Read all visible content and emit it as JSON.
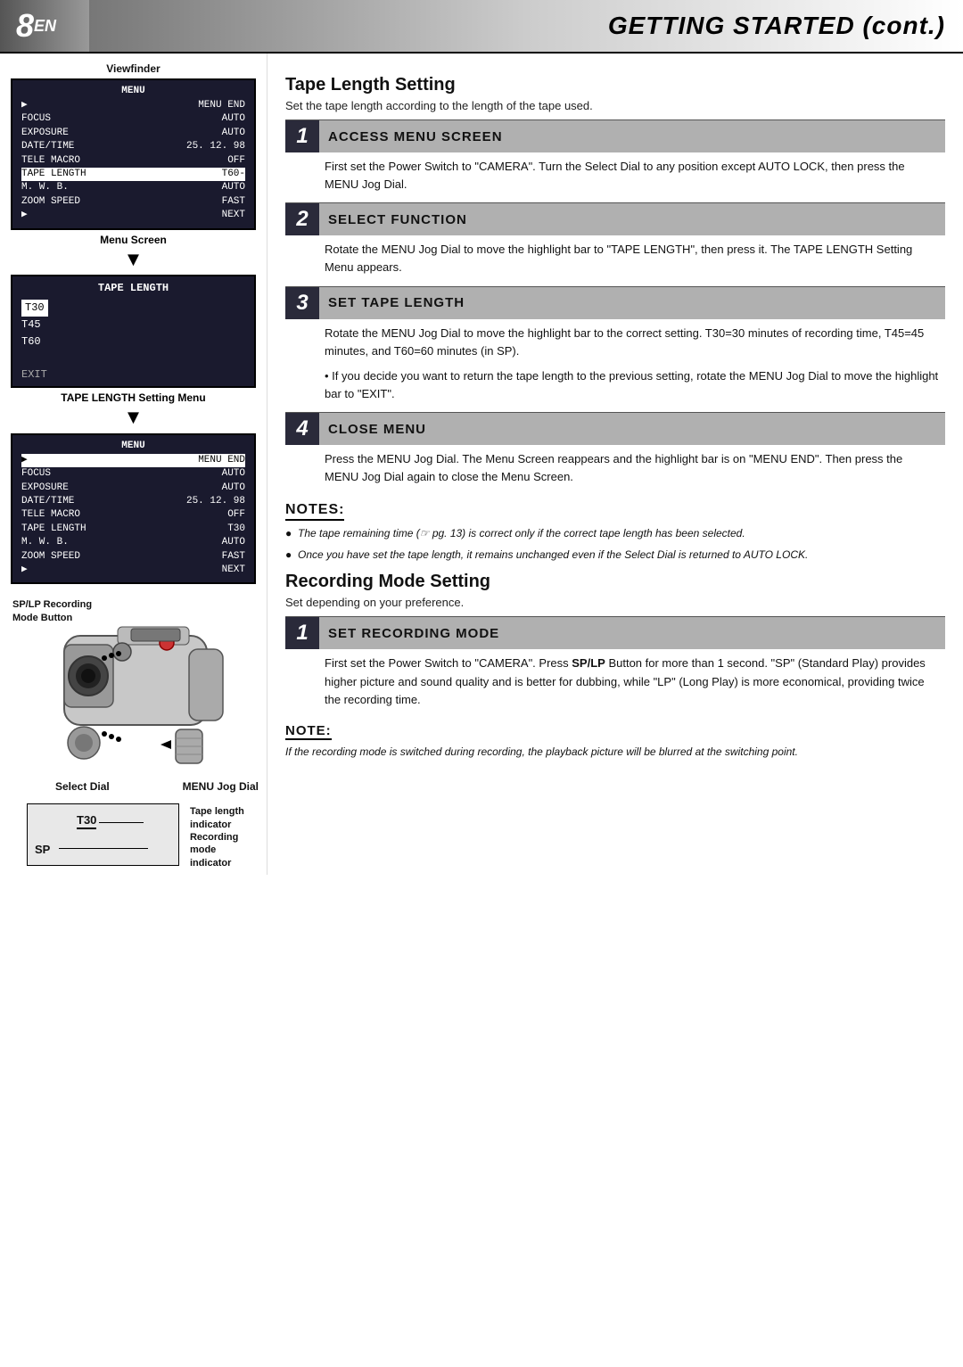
{
  "header": {
    "page_num": "8",
    "page_suffix": "EN",
    "title": "GETTING STARTED (cont.)"
  },
  "left_col": {
    "viewfinder_label": "Viewfinder",
    "menu_screen_label": "Menu Screen",
    "tape_length_menu_label": "TAPE LENGTH Setting Menu",
    "menu1": {
      "title": "MENU",
      "items": [
        {
          "label": "MENU END",
          "value": "",
          "arrow": true,
          "highlighted": false
        },
        {
          "label": "FOCUS",
          "value": "AUTO",
          "highlighted": false
        },
        {
          "label": "EXPOSURE",
          "value": "AUTO",
          "highlighted": false
        },
        {
          "label": "DATE/TIME",
          "value": "25. 12. 98",
          "highlighted": false
        },
        {
          "label": "TELE MACRO",
          "value": "OFF",
          "highlighted": false
        },
        {
          "label": "TAPE LENGTH",
          "value": "T60-",
          "highlighted": true
        },
        {
          "label": "M. W. B.",
          "value": "AUTO",
          "highlighted": false
        },
        {
          "label": "ZOOM SPEED",
          "value": "FAST",
          "highlighted": false
        },
        {
          "label": "NEXT",
          "value": "",
          "arrow": true,
          "highlighted": false
        }
      ]
    },
    "tape_length_box": {
      "title": "TAPE LENGTH",
      "items": [
        "T30",
        "T45",
        "T60"
      ],
      "selected": "T30",
      "exit_label": "EXIT"
    },
    "menu2": {
      "title": "MENU",
      "items": [
        {
          "label": "MENU END",
          "value": "",
          "arrow": true,
          "highlighted": true
        },
        {
          "label": "FOCUS",
          "value": "AUTO",
          "highlighted": false
        },
        {
          "label": "EXPOSURE",
          "value": "AUTO",
          "highlighted": false
        },
        {
          "label": "DATE/TIME",
          "value": "25. 12. 98",
          "highlighted": false
        },
        {
          "label": "TELE MACRO",
          "value": "OFF",
          "highlighted": false
        },
        {
          "label": "TAPE LENGTH",
          "value": "T30",
          "highlighted": false
        },
        {
          "label": "M. W. B.",
          "value": "AUTO",
          "highlighted": false
        },
        {
          "label": "ZOOM SPEED",
          "value": "FAST",
          "highlighted": false
        },
        {
          "label": "NEXT",
          "value": "",
          "arrow": true,
          "highlighted": false
        }
      ]
    },
    "sp_lp_label": "SP/LP Recording\nMode Button",
    "select_dial_label": "Select Dial",
    "menu_jog_label": "MENU Jog Dial",
    "indicator": {
      "sp": "SP",
      "t30": "T30",
      "tape_length_label": "Tape length\nindicator",
      "rec_mode_label": "Recording mode\nindicator"
    }
  },
  "right_col": {
    "tape_length": {
      "title": "Tape Length Setting",
      "desc": "Set the tape length according to the length of the tape used.",
      "steps": [
        {
          "number": "1",
          "header": "ACCESS MENU SCREEN",
          "body": "First set the Power Switch to \"CAMERA\". Turn the Select Dial to any position except AUTO LOCK, then press the MENU Jog Dial."
        },
        {
          "number": "2",
          "header": "SELECT FUNCTION",
          "body": "Rotate the MENU Jog Dial to move the highlight bar to \"TAPE LENGTH\", then press it. The TAPE LENGTH Setting Menu appears."
        },
        {
          "number": "3",
          "header": "SET TAPE LENGTH",
          "body": "Rotate the MENU Jog Dial to move the highlight bar to the correct setting. T30=30 minutes of recording time, T45=45 minutes, and T60=60 minutes (in SP).",
          "bullet": "If  you decide you want to return the tape length to the previous setting, rotate the MENU Jog Dial to move the highlight bar to \"EXIT\"."
        },
        {
          "number": "4",
          "header": "CLOSE MENU",
          "body": "Press the MENU Jog Dial. The Menu Screen reappears and the highlight bar is on \"MENU END\". Then press the MENU Jog Dial again to close the Menu Screen."
        }
      ]
    },
    "notes": {
      "title": "NOTES:",
      "items": [
        "The tape remaining time (☞ pg. 13) is correct only if the correct tape length has been selected.",
        "Once you have set the tape length, it remains unchanged even if the Select Dial is returned to AUTO LOCK."
      ]
    },
    "recording_mode": {
      "title": "Recording Mode Setting",
      "desc": "Set depending on your preference.",
      "steps": [
        {
          "number": "1",
          "header": "SET RECORDING MODE",
          "body_parts": [
            "First set the Power Switch to \"CAMERA\". Press ",
            "SP/LP",
            " Button for more than 1 second. \"SP\" (Standard Play) provides higher picture and sound quality and is better for dubbing, while \"LP\" (Long Play) is more economical, providing twice the recording time."
          ]
        }
      ]
    },
    "note_single": {
      "title": "NOTE:",
      "text": "If the recording mode is switched during recording, the playback picture will be blurred at the switching point."
    }
  }
}
